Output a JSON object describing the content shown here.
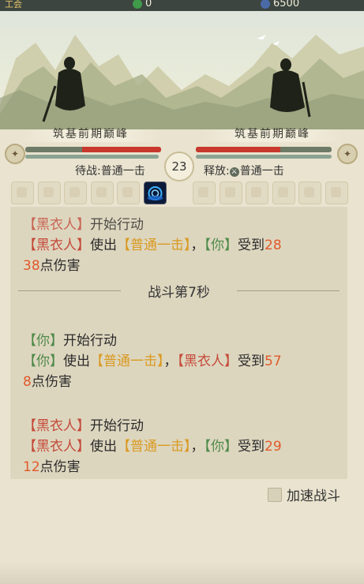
{
  "top_bar": {
    "left_label": "工会",
    "jade_amount": "0",
    "spirit_stone_amount": "6500",
    "jade_icon": "jade-icon",
    "spirit_stone_icon": "spirit-stone-icon"
  },
  "player": {
    "realm": "筑基前期巅峰",
    "hp_fraction": 0.58,
    "mp_fraction": 0.98,
    "pending_action_label": "待战:普通一击"
  },
  "enemy": {
    "realm": "筑基前期巅峰",
    "hp_fraction": 0.62,
    "mp_fraction": 1.0,
    "release_prefix": "释放:",
    "release_skill": "普通一击"
  },
  "round_timer": "23",
  "skill_slots": {
    "left_count": 6,
    "right_count": 6,
    "active_index_left": 5
  },
  "log": {
    "partial_top": {
      "actor": "【黑衣人】",
      "text": "开始行动"
    },
    "entry1_line1": {
      "actor": "【黑衣人】",
      "verb": "使出",
      "skill": "【普通一击】",
      "sep": "，",
      "target": "【你】",
      "result": "受到",
      "dmg_a": "28"
    },
    "entry1_line2": {
      "dmg_b": "38",
      "suffix": "点伤害"
    },
    "divider": "战斗第7秒",
    "entry2_start": {
      "actor": "【你】",
      "text": "开始行动"
    },
    "entry2_line1": {
      "actor": "【你】",
      "verb": "使出",
      "skill": "【普通一击】",
      "sep": "，",
      "target": "【黑衣人】",
      "result": "受到",
      "dmg_a": "57"
    },
    "entry2_line2": {
      "dmg_b": "8",
      "suffix": "点伤害"
    },
    "entry3_start": {
      "actor": "【黑衣人】",
      "text": "开始行动"
    },
    "entry3_line1": {
      "actor": "【黑衣人】",
      "verb": "使出",
      "skill": "【普通一击】",
      "sep": "，",
      "target": "【你】",
      "result": "受到",
      "dmg_a": "29"
    },
    "entry3_line2": {
      "dmg_b": "12",
      "suffix": "点伤害"
    }
  },
  "speed_toggle": {
    "label": "加速战斗",
    "checked": false
  },
  "colors": {
    "player_name": "#4f8a4a",
    "enemy_name": "#c54a3a",
    "skill_name": "#d99a22",
    "damage": "#e05a2a",
    "hp_fill": "#c8382c"
  }
}
